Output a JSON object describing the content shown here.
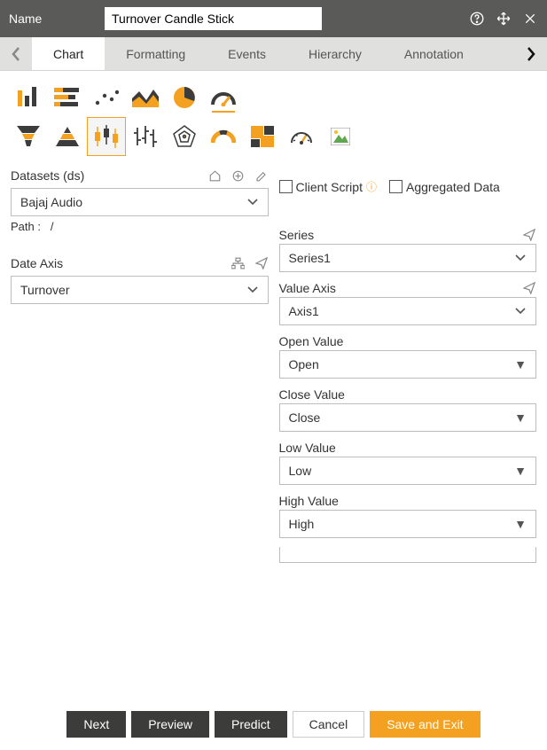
{
  "header": {
    "name_label": "Name",
    "name_value": "Turnover Candle Stick"
  },
  "tabs": {
    "items": [
      "Chart",
      "Formatting",
      "Events",
      "Hierarchy",
      "Annotation"
    ],
    "active": 0
  },
  "chart_types": {
    "icons": [
      "bar-chart-icon",
      "stacked-bar-icon",
      "scatter-icon",
      "area-chart-icon",
      "pie-chart-icon",
      "gauge-icon",
      "funnel-icon",
      "pyramid-icon",
      "candlestick-icon",
      "ohlc-icon",
      "radar-icon",
      "semi-gauge-icon",
      "treemap-icon",
      "speedometer-icon",
      "image-icon"
    ],
    "active_index": 8,
    "underline_index": 5
  },
  "datasets": {
    "label": "Datasets (ds)",
    "value": "Bajaj Audio",
    "path_label": "Path :",
    "path_value": "/"
  },
  "options": {
    "client_script_label": "Client Script",
    "aggregated_label": "Aggregated Data"
  },
  "date_axis": {
    "label": "Date Axis",
    "value": "Turnover"
  },
  "series": {
    "label": "Series",
    "value": "Series1"
  },
  "value_axis": {
    "label": "Value Axis",
    "value": "Axis1"
  },
  "fields": {
    "open": {
      "label": "Open Value",
      "value": "Open"
    },
    "close": {
      "label": "Close Value",
      "value": "Close"
    },
    "low": {
      "label": "Low Value",
      "value": "Low"
    },
    "high": {
      "label": "High Value",
      "value": "High"
    }
  },
  "footer": {
    "next": "Next",
    "preview": "Preview",
    "predict": "Predict",
    "cancel": "Cancel",
    "save": "Save and Exit"
  }
}
